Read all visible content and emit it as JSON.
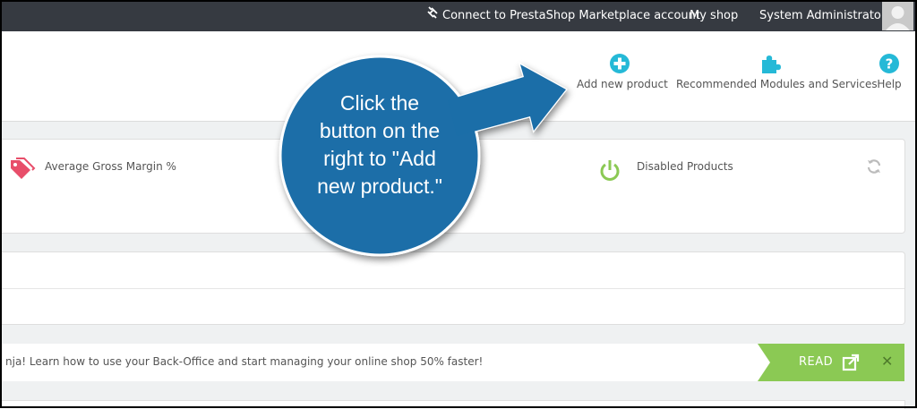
{
  "topbar": {
    "connect_label": "Connect to PrestaShop Marketplace account",
    "myshop_label": "My shop",
    "admin_label": "System Administrator"
  },
  "toolbar": {
    "add_label": "Add new product",
    "recommended_label": "Recommended Modules and Services",
    "help_label": "Help"
  },
  "kpi": {
    "gross_margin_label": "Average Gross Margin %",
    "disabled_label": "Disabled Products"
  },
  "notice": {
    "text": "nja! Learn how to use your Back-Office and start managing your online shop 50% faster!",
    "read_label": "READ",
    "close_symbol": "✕"
  },
  "callout": {
    "line1": "Click the",
    "line2": "button on the",
    "line3": "right to \"Add",
    "line4": "new product.\""
  },
  "colors": {
    "topbar_bg": "#363a41",
    "accent_blue": "#25b9d7",
    "callout_blue": "#1b6ea8",
    "green": "#8bc954",
    "red_tag": "#e84e6a"
  },
  "icons": [
    "plug-icon",
    "plus-circle-icon",
    "puzzle-icon",
    "question-circle-icon",
    "tag-icon",
    "power-icon",
    "refresh-icon",
    "external-link-icon",
    "close-icon"
  ]
}
